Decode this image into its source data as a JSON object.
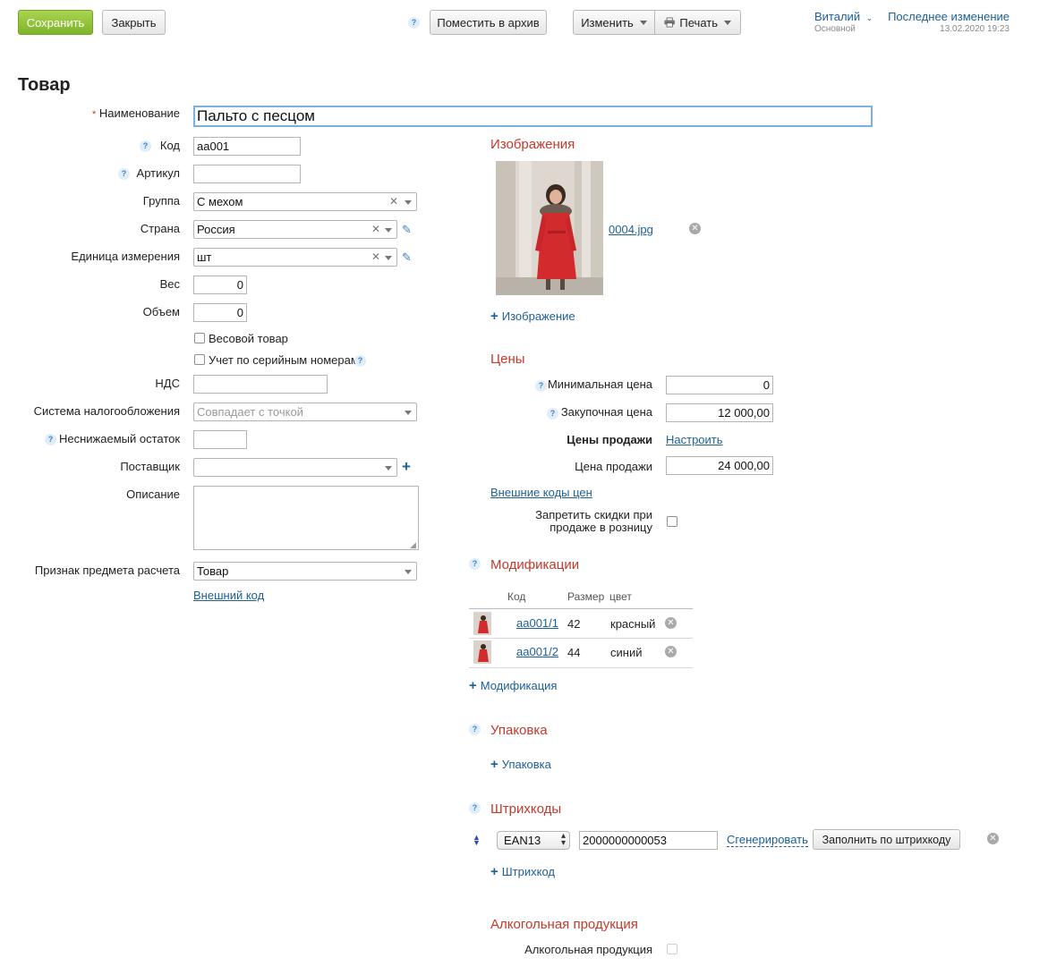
{
  "toolbar": {
    "save_label": "Сохранить",
    "close_label": "Закрыть",
    "help_mark": "?",
    "archive_label": "Поместить в архив",
    "edit_label": "Изменить",
    "print_label": "Печать"
  },
  "user": {
    "name": "Виталий",
    "role": "Основной",
    "last_change_label": "Последнее изменение",
    "last_change_date": "13.02.2020 19:23"
  },
  "page_title": "Товар",
  "form": {
    "name": {
      "label": "Наименование",
      "required_mark": "*",
      "value": "Пальто с песцом"
    },
    "code": {
      "label": "Код",
      "value": "аа001"
    },
    "article": {
      "label": "Артикул",
      "value": ""
    },
    "group": {
      "label": "Группа",
      "value": "С мехом"
    },
    "country": {
      "label": "Страна",
      "value": "Россия"
    },
    "unit": {
      "label": "Единица измерения",
      "value": "шт"
    },
    "weight": {
      "label": "Вес",
      "value": "0"
    },
    "volume": {
      "label": "Объем",
      "value": "0"
    },
    "weighted_item": {
      "label": "Весовой товар",
      "checked": false
    },
    "serial_tracking": {
      "label": "Учет по серийным номерам",
      "checked": false
    },
    "vat": {
      "label": "НДС",
      "value": ""
    },
    "tax_system": {
      "label": "Система налогообложения",
      "placeholder": "Совпадает с точкой"
    },
    "min_balance": {
      "label": "Неснижаемый остаток",
      "value": ""
    },
    "supplier": {
      "label": "Поставщик",
      "value": ""
    },
    "description": {
      "label": "Описание",
      "value": ""
    },
    "payment_subject": {
      "label": "Признак предмета расчета",
      "value": "Товар"
    },
    "external_code_link": "Внешний код"
  },
  "images": {
    "title": "Изображения",
    "file_name": "0004.jpg",
    "add_label": "Изображение"
  },
  "prices": {
    "title": "Цены",
    "min_price": {
      "label": "Минимальная цена",
      "value": "0"
    },
    "purchase_price": {
      "label": "Закупочная цена",
      "value": "12 000,00"
    },
    "sale_prices_label": "Цены продажи",
    "configure_link": "Настроить",
    "sale_price": {
      "label": "Цена продажи",
      "value": "24 000,00"
    },
    "external_price_codes_link": "Внешние коды цен",
    "forbid_discounts": {
      "label_line1": "Запретить скидки при",
      "label_line2": "продаже в розницу",
      "checked": false
    }
  },
  "modifications": {
    "title": "Модификации",
    "columns": [
      "Код",
      "Размер",
      "цвет"
    ],
    "rows": [
      {
        "code": "аа001/1",
        "size": "42",
        "color": "красный"
      },
      {
        "code": "аа001/2",
        "size": "44",
        "color": "синий"
      }
    ],
    "add_label": "Модификация"
  },
  "packaging": {
    "title": "Упаковка",
    "add_label": "Упаковка"
  },
  "barcodes": {
    "title": "Штрихкоды",
    "type": "EAN13",
    "value": "2000000000053",
    "generate_link": "Сгенерировать",
    "fill_button": "Заполнить по штрихкоду",
    "add_label": "Штрихкод"
  },
  "alcohol": {
    "title": "Алкогольная продукция",
    "label": "Алкогольная продукция",
    "checked": false
  },
  "colors": {
    "save_green": "#8cbf35",
    "section_red": "#c23a2b",
    "link_blue": "#1c5f99",
    "coat_red": "#d32a2e"
  },
  "icons": [
    "help-icon",
    "print-icon",
    "chevron-down-icon",
    "pencil-icon",
    "remove-icon",
    "plus-icon",
    "sort-arrows-icon"
  ]
}
